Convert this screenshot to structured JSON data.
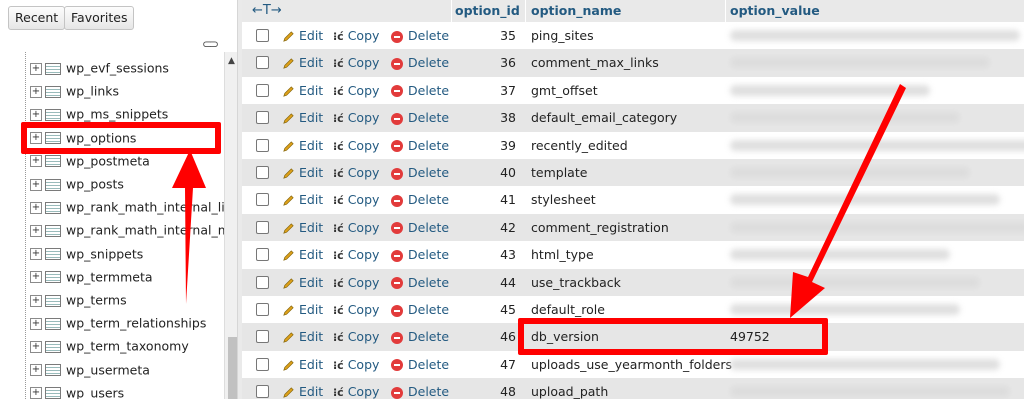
{
  "nav": {
    "tab_recent": "Recent",
    "tab_favorites": "Favorites",
    "link_icon": "link-icon",
    "tables": [
      "wp_evf_sessions",
      "wp_links",
      "wp_ms_snippets",
      "wp_options",
      "wp_postmeta",
      "wp_posts",
      "wp_rank_math_internal_lin",
      "wp_rank_math_internal_m",
      "wp_snippets",
      "wp_termmeta",
      "wp_terms",
      "wp_term_relationships",
      "wp_term_taxonomy",
      "wp_usermeta",
      "wp_users"
    ],
    "highlighted": "wp_options"
  },
  "grid": {
    "columns": {
      "arrows": "←T→",
      "option_id": "option_id",
      "option_name": "option_name",
      "option_value": "option_value"
    },
    "actions": {
      "edit": "Edit",
      "copy": "Copy",
      "delete": "Delete"
    },
    "rows": [
      {
        "id": "35",
        "name": "ping_sites",
        "value": ""
      },
      {
        "id": "36",
        "name": "comment_max_links",
        "value": ""
      },
      {
        "id": "37",
        "name": "gmt_offset",
        "value": ""
      },
      {
        "id": "38",
        "name": "default_email_category",
        "value": ""
      },
      {
        "id": "39",
        "name": "recently_edited",
        "value": ""
      },
      {
        "id": "40",
        "name": "template",
        "value": ""
      },
      {
        "id": "41",
        "name": "stylesheet",
        "value": ""
      },
      {
        "id": "42",
        "name": "comment_registration",
        "value": ""
      },
      {
        "id": "43",
        "name": "html_type",
        "value": ""
      },
      {
        "id": "44",
        "name": "use_trackback",
        "value": ""
      },
      {
        "id": "45",
        "name": "default_role",
        "value": ""
      },
      {
        "id": "46",
        "name": "db_version",
        "value": "49752"
      },
      {
        "id": "47",
        "name": "uploads_use_yearmonth_folders",
        "value": ""
      },
      {
        "id": "48",
        "name": "upload_path",
        "value": ""
      }
    ],
    "highlighted_name": "db_version"
  },
  "colors": {
    "annotation": "#ff0000",
    "link": "#235a81",
    "row_alt": "#e6e6e6"
  }
}
